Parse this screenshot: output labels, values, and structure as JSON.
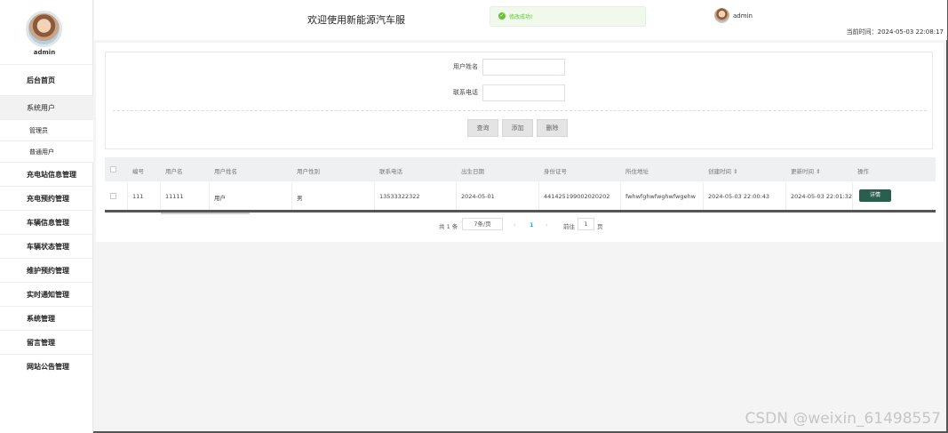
{
  "sidebar": {
    "user": "admin",
    "items": [
      {
        "label": "后台首页"
      },
      {
        "label": "系统用户"
      },
      {
        "label": "管理员"
      },
      {
        "label": "普通用户"
      },
      {
        "label": "充电站信息管理"
      },
      {
        "label": "充电预约管理"
      },
      {
        "label": "车辆信息管理"
      },
      {
        "label": "车辆状态管理"
      },
      {
        "label": "维护预约管理"
      },
      {
        "label": "实时通知管理"
      },
      {
        "label": "系统管理"
      },
      {
        "label": "留言管理"
      },
      {
        "label": "网站公告管理"
      }
    ]
  },
  "header": {
    "welcome": "欢迎使用新能源汽车服",
    "toast": "修改成功!",
    "user": "admin",
    "current_time": "当前时间：2024-05-03 22:08:17"
  },
  "search": {
    "name_label": "用户姓名",
    "phone_label": "联系电话",
    "query": "查询",
    "add": "添加",
    "delete": "删除"
  },
  "table": {
    "headers": [
      "编号",
      "用户名",
      "用户姓名",
      "用户性别",
      "联系电话",
      "出生日期",
      "身份证号",
      "所住地址",
      "创建时间 ⇕",
      "更新时间 ⇕",
      "操作"
    ],
    "rows": [
      [
        "111",
        "11111",
        "用户",
        "男",
        "13533322322",
        "2024-05-01",
        "441425199002020202",
        "fwhwfghwfwghwfwgehw",
        "2024-05-03 22:00:43",
        "2024-05-03 22:01:32"
      ]
    ],
    "detail_label": "详情"
  },
  "pagination": {
    "total": "共 1 条",
    "page_size": "7条/页",
    "prev": "‹",
    "page": "1",
    "next": "›",
    "goto": "前往",
    "goto_value": "1",
    "page_suffix": "页"
  },
  "watermark": "CSDN @weixin_61498557",
  "colors": {
    "accent": "#2a5f4f",
    "success": "#67c23a",
    "active_page": "#409eff"
  }
}
